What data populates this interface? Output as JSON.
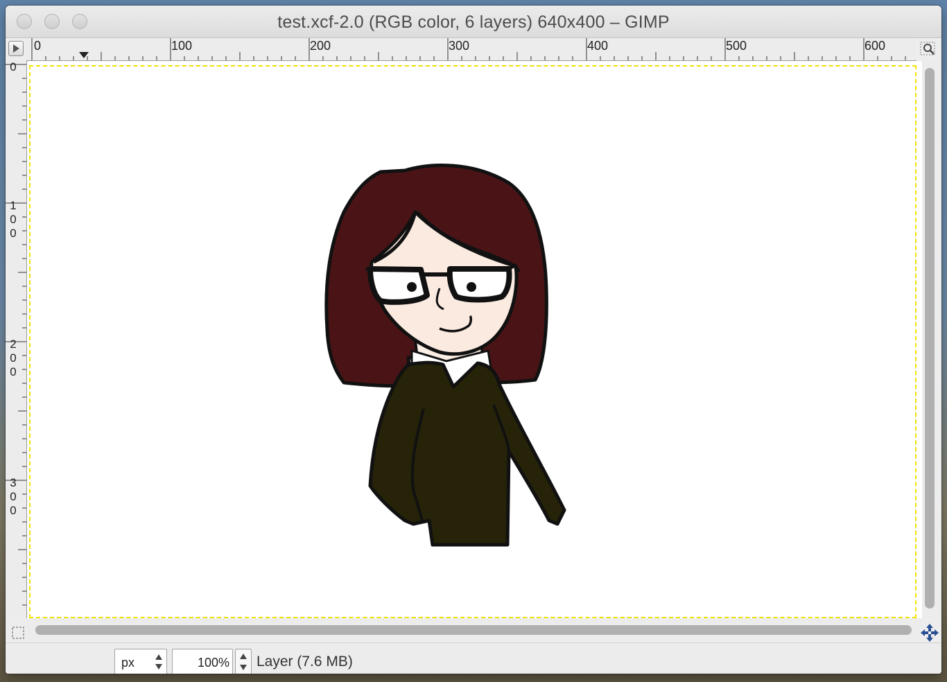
{
  "window": {
    "title": "test.xcf-2.0 (RGB color, 6 layers) 640x400 – GIMP"
  },
  "rulers": {
    "horizontal_labels": [
      "0",
      "100",
      "200",
      "300",
      "400",
      "500",
      "600"
    ],
    "vertical_labels": [
      "0",
      "100",
      "200",
      "300"
    ]
  },
  "statusbar": {
    "unit": "px",
    "zoom": "100%",
    "message": "Layer (7.6 MB)"
  },
  "icons": {
    "navigate": "navigate-menu-icon",
    "zoom": "zoom-fit-icon",
    "quick_mask": "quick-mask-icon",
    "move": "navigation-move-icon"
  }
}
